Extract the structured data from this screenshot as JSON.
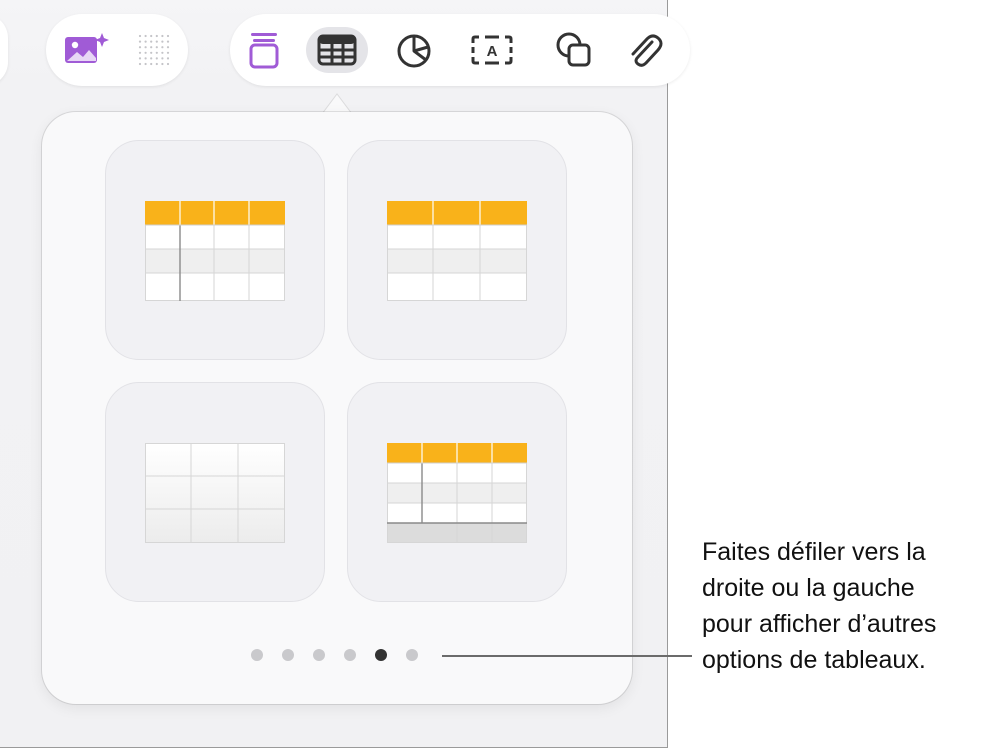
{
  "toolbar": {
    "media_tools": [
      {
        "icon": "image-sparkle-icon",
        "color": "#a05bd6"
      },
      {
        "icon": "dot-grid-icon",
        "color": "#c4c4c8"
      }
    ],
    "insert_tools": [
      {
        "icon": "text-box-stack-icon",
        "color": "#a05bd6",
        "selected": false
      },
      {
        "icon": "table-icon",
        "color": "#333333",
        "selected": true
      },
      {
        "icon": "pie-chart-icon",
        "color": "#333333",
        "selected": false
      },
      {
        "icon": "text-box-a-icon",
        "label": "A",
        "color": "#333333",
        "selected": false
      },
      {
        "icon": "shapes-icon",
        "color": "#333333",
        "selected": false
      },
      {
        "icon": "paperclip-icon",
        "color": "#333333",
        "selected": false
      }
    ]
  },
  "popover": {
    "table_styles": [
      {
        "name": "table-style-header-row-col",
        "header_color": "#f9b21a"
      },
      {
        "name": "table-style-header-row",
        "header_color": "#f9b21a"
      },
      {
        "name": "table-style-plain",
        "header_color": "#ffffff"
      },
      {
        "name": "table-style-header-row-col-footer",
        "header_color": "#f9b21a"
      }
    ],
    "pager": {
      "page_count": 6,
      "current_page": 5
    }
  },
  "callout": {
    "lines": [
      "Faites défiler vers la",
      "droite ou la gauche",
      "pour afficher d’autres",
      "options de tableaux."
    ]
  },
  "colors": {
    "accent_purple": "#a05bd6",
    "table_header_yellow": "#f9b21a",
    "dot_active": "#333333",
    "dot_inactive": "#c9c9cc"
  }
}
